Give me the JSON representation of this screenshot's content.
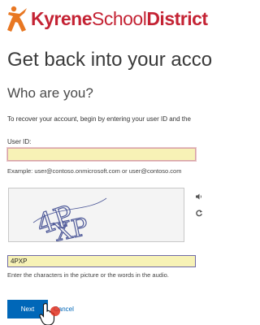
{
  "brand": {
    "name_bold": "Kyrene",
    "name_light": "School",
    "name_bold_2": "District",
    "color": "#c42334"
  },
  "page": {
    "title": "Get back into your accoun",
    "subtitle": "Who are you?",
    "intro": "To recover your account, begin by entering your user ID and the"
  },
  "user_id": {
    "label": "User ID:",
    "value": "",
    "example": "Example: user@contoso.onmicrosoft.com or user@contoso.com"
  },
  "captcha": {
    "image_text": "4PXP",
    "audio_icon": "speaker-icon",
    "refresh_icon": "refresh-icon",
    "input_value": "4PXP",
    "hint": "Enter the characters in the picture or the words in the audio."
  },
  "actions": {
    "next_label": "Next",
    "cancel_label": "Cancel",
    "accent": "#0067b8"
  }
}
